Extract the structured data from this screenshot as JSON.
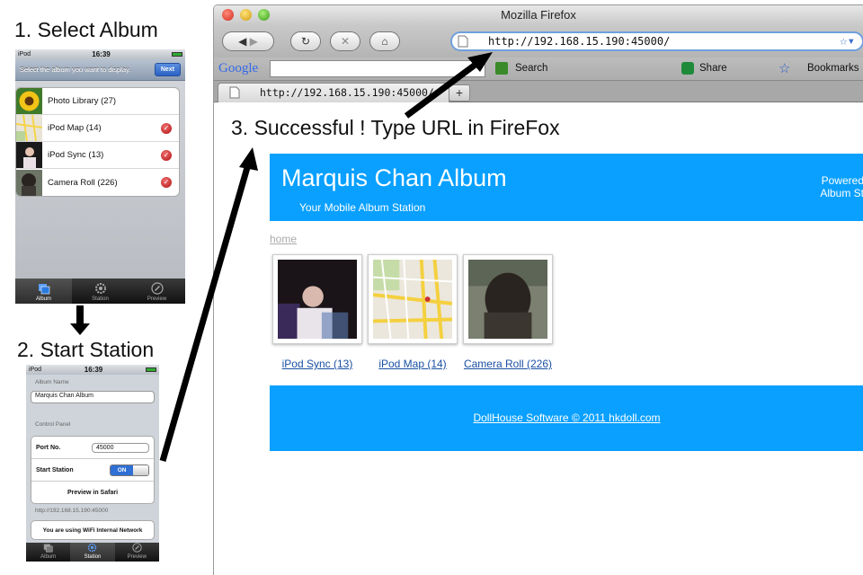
{
  "steps": {
    "step1": "1. Select Album",
    "step2": "2. Start Station",
    "step3": "3. Successful ! Type URL in FireFox"
  },
  "phone1": {
    "carrier": "iPod",
    "time": "16:39",
    "instruction": "Select the album you want to display.",
    "next_label": "Next",
    "albums": [
      {
        "label": "Photo Library (27)",
        "checked": false
      },
      {
        "label": "iPod Map (14)",
        "checked": true
      },
      {
        "label": "iPod Sync (13)",
        "checked": true
      },
      {
        "label": "Camera Roll (226)",
        "checked": true
      }
    ],
    "tabs": [
      "Album",
      "Station",
      "Preview"
    ],
    "active_tab": "Album"
  },
  "phone2": {
    "carrier": "iPod",
    "time": "16:39",
    "album_name_label": "Album Name",
    "album_name_value": "Marquis Chan Album",
    "control_panel_label": "Control Panel",
    "port_label": "Port No.",
    "port_value": "45000",
    "start_station_label": "Start Station",
    "toggle_label": "ON",
    "preview_label": "Preview in Safari",
    "station_url": "http://192.168.15.190:45000",
    "network_msg": "You are using WiFi Internal Network",
    "tabs": [
      "Album",
      "Station",
      "Preview"
    ],
    "active_tab": "Station"
  },
  "firefox": {
    "window_title": "Mozilla Firefox",
    "url": "http://192.168.15.190:45000/",
    "tab_title": "http://192.168.15.190:45000/",
    "search_engine": "Google",
    "toolbar": {
      "search_label": "Search",
      "share_label": "Share",
      "bookmarks_label": "Bookmarks"
    }
  },
  "site": {
    "title": "Marquis Chan Album",
    "subtitle": "Your Mobile Album Station",
    "powered_line1": "Powered",
    "powered_line2": "Album St",
    "home_link": "home",
    "albums": [
      {
        "label": "iPod Sync (13)"
      },
      {
        "label": "iPod Map (14)"
      },
      {
        "label": "Camera Roll (226)"
      }
    ],
    "footer": "DollHouse Software © 2011 hkdoll.com"
  },
  "colors": {
    "site_blue": "#09a0ff",
    "link_blue": "#1a4fa3",
    "check_red": "#c01515",
    "toggle_blue": "#2f6fd6"
  }
}
